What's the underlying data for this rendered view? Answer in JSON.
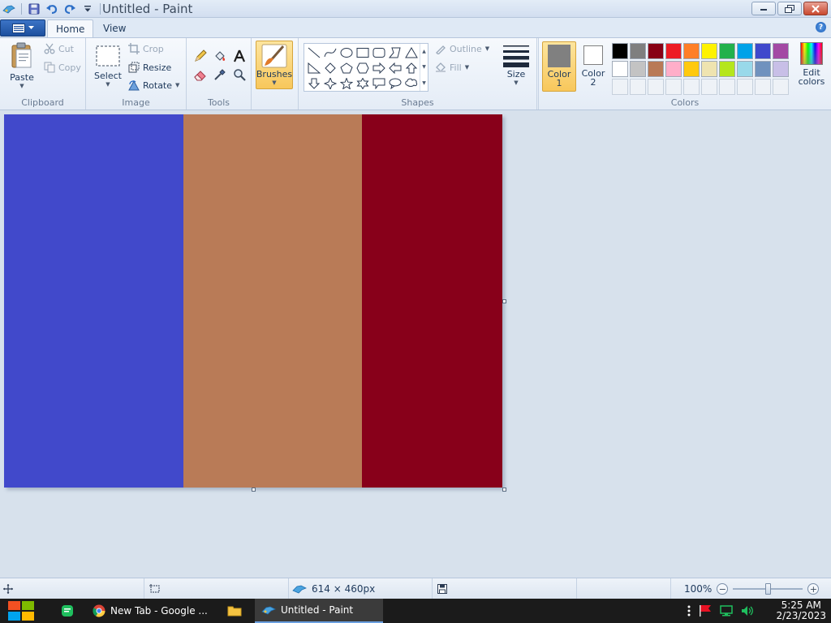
{
  "window": {
    "title": "Untitled - Paint"
  },
  "tabs": {
    "home": "Home",
    "view": "View"
  },
  "help_label": "?",
  "clipboard": {
    "paste": "Paste",
    "cut": "Cut",
    "copy": "Copy",
    "group_label": "Clipboard"
  },
  "image": {
    "select": "Select",
    "crop": "Crop",
    "resize": "Resize",
    "rotate": "Rotate",
    "group_label": "Image"
  },
  "tools": {
    "group_label": "Tools",
    "items": [
      "pencil-icon",
      "fill-icon",
      "text-icon",
      "eraser-icon",
      "color-picker-icon",
      "magnifier-icon"
    ]
  },
  "brushes": {
    "label": "Brushes"
  },
  "shapes": {
    "group_label": "Shapes",
    "outline": "Outline",
    "fill": "Fill"
  },
  "size": {
    "label": "Size"
  },
  "colors": {
    "group_label": "Colors",
    "color1_line1": "Color",
    "color1_line2": "1",
    "color2_line1": "Color",
    "color2_line2": "2",
    "color1_value": "#808080",
    "color2_value": "#ffffff",
    "edit_line1": "Edit",
    "edit_line2": "colors",
    "palette_row1": [
      "#000000",
      "#7f7f7f",
      "#880015",
      "#ed1c24",
      "#ff7f27",
      "#fff200",
      "#22b14c",
      "#00a2e8",
      "#3f48cc",
      "#a349a4"
    ],
    "palette_row2": [
      "#ffffff",
      "#c3c3c3",
      "#b97a57",
      "#ffaec9",
      "#ffc90e",
      "#efe4b0",
      "#b5e61d",
      "#99d9ea",
      "#7092be",
      "#c8bfe7"
    ]
  },
  "canvas": {
    "stripes": [
      "#4149cb",
      "#b97b57",
      "#88001a"
    ],
    "stripe_widths": [
      221,
      220,
      173
    ]
  },
  "statusbar": {
    "dimensions": "614 × 460px",
    "zoom": "100%",
    "zoom_fraction": 0.5
  },
  "taskbar": {
    "chrome_task": "New Tab - Google ...",
    "paint_task": "Untitled - Paint",
    "time": "5:25 AM",
    "date": "2/23/2023"
  }
}
